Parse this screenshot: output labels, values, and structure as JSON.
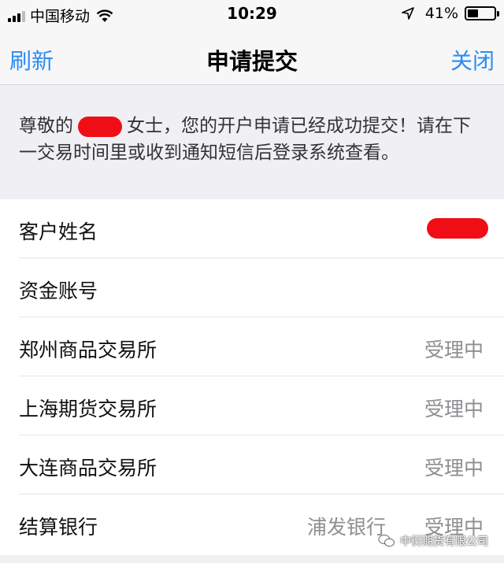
{
  "status_bar": {
    "carrier": "中国移动",
    "time": "10:29",
    "battery": "41%",
    "battery_level": 0.41
  },
  "nav": {
    "left": "刷新",
    "title": "申请提交",
    "right": "关闭"
  },
  "message": {
    "prefix": "尊敬的",
    "suffix": "女士，您的开户申请已经成功提交！请在下一交易时间里或收到通知短信后登录系统查看。"
  },
  "rows": [
    {
      "label": "客户姓名",
      "value": ""
    },
    {
      "label": "资金账号",
      "value": ""
    },
    {
      "label": "郑州商品交易所",
      "value": "受理中"
    },
    {
      "label": "上海期货交易所",
      "value": "受理中"
    },
    {
      "label": "大连商品交易所",
      "value": "受理中"
    },
    {
      "label": "结算银行",
      "value": "受理中",
      "bank": "浦发银行"
    }
  ],
  "watermark": "中衍期货有限公司",
  "colors": {
    "accent": "#2d8cf0",
    "redaction": "#f00e16"
  }
}
